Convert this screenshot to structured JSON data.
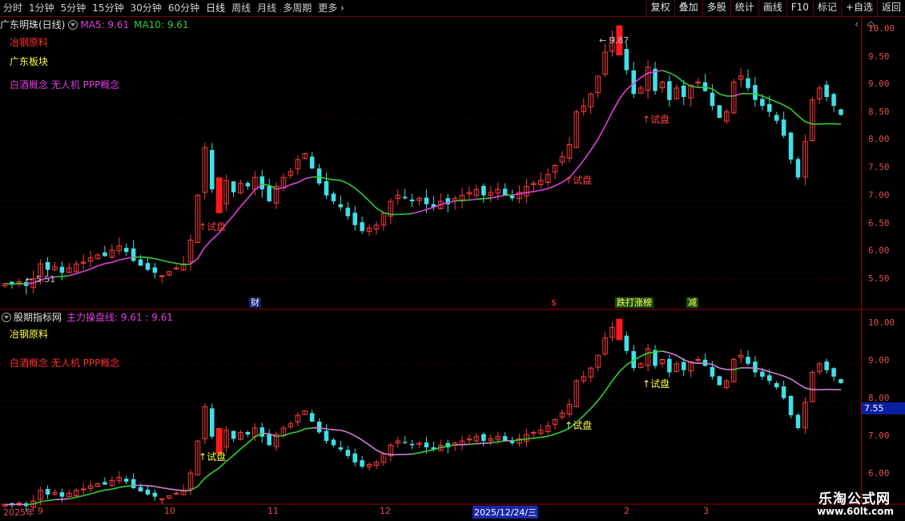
{
  "toolbar": {
    "tabs": [
      "分时",
      "1分钟",
      "5分钟",
      "15分钟",
      "30分钟",
      "60分钟",
      "日线",
      "周线",
      "月线",
      "多周期",
      "更多"
    ],
    "active_tab": "日线",
    "buttons": [
      "复权",
      "叠加",
      "多股",
      "统计",
      "画线",
      "F10",
      "标记",
      "+自选",
      "返回"
    ]
  },
  "main_panel": {
    "stock_title": "广东明珠(日线)",
    "ma5_label": "MA5: 9.61",
    "ma10_label": "MA10: 9.61",
    "ma5_color": "#e040e0",
    "ma10_color": "#30d030",
    "annotations": {
      "sector1": "冶钢原料",
      "sector2": "广东板块",
      "concepts": "白酒概念 无人机 PPP概念"
    },
    "high_marker": "9.87",
    "low_marker": "5.51",
    "signal_label": "试盘",
    "y_ticks": [
      "10.00",
      "9.50",
      "9.00",
      "8.50",
      "8.00",
      "7.50",
      "7.00",
      "6.50",
      "6.00",
      "5.50"
    ]
  },
  "event_markers": {
    "fin": "财",
    "dollar": "$",
    "limit": "跌打涨榜",
    "reduce": "减"
  },
  "sub_panel": {
    "indicator_title": "股期指标网",
    "line_label": "主力操盘线: 9.61 : 9.61",
    "annotations": {
      "sector1": "冶钢原料",
      "concepts": "白酒概念 无人机 PPP概念"
    },
    "signal_label": "试盘",
    "y_ticks": [
      "10.00",
      "9.00",
      "8.00",
      "7.00",
      "6.00"
    ],
    "current_value": "7.55"
  },
  "x_axis": {
    "labels": [
      "2025年",
      "9",
      "10",
      "11",
      "12",
      "2025/12/24/三",
      "2",
      "3"
    ]
  },
  "watermark": {
    "brand": "乐淘公式网",
    "url": "www.60lt.com"
  },
  "chart_data": {
    "type": "candlestick",
    "up_color": "#ff3b3b",
    "down_color": "#40e0e8",
    "series_close": [
      5.72,
      5.7,
      5.75,
      5.68,
      5.8,
      6.05,
      5.95,
      6.0,
      5.9,
      5.98,
      6.05,
      6.08,
      6.15,
      6.2,
      6.18,
      6.28,
      6.35,
      6.25,
      6.1,
      6.02,
      5.95,
      5.9,
      5.85,
      5.92,
      5.98,
      6.05,
      6.45,
      7.2,
      8.0,
      7.3,
      7.05,
      7.45,
      7.25,
      7.4,
      7.35,
      7.5,
      7.3,
      7.1,
      7.35,
      7.5,
      7.6,
      7.8,
      7.9,
      7.65,
      7.4,
      7.2,
      7.1,
      7.0,
      6.85,
      6.7,
      6.6,
      6.65,
      6.7,
      6.9,
      7.1,
      7.2,
      7.15,
      7.1,
      7.15,
      7.05,
      7.0,
      7.1,
      7.05,
      7.15,
      7.2,
      7.25,
      7.3,
      7.2,
      7.25,
      7.3,
      7.2,
      7.15,
      7.25,
      7.35,
      7.4,
      7.45,
      7.55,
      7.7,
      7.85,
      8.05,
      8.6,
      8.7,
      8.9,
      9.2,
      9.6,
      9.85,
      9.7,
      9.3,
      8.9,
      9.0,
      9.35,
      8.95,
      9.1,
      8.8,
      9.0,
      8.85,
      9.05,
      9.1,
      8.95,
      8.7,
      8.5,
      8.6,
      9.1,
      9.2,
      9.0,
      8.8,
      8.7,
      8.6,
      8.45,
      8.2,
      7.8,
      7.5,
      8.1,
      8.8,
      9.0,
      8.85,
      8.7,
      8.55
    ],
    "ylim_main": [
      5.3,
      10.1
    ],
    "ylim_sub": [
      5.8,
      10.1
    ],
    "signals_at": [
      30,
      86
    ]
  }
}
